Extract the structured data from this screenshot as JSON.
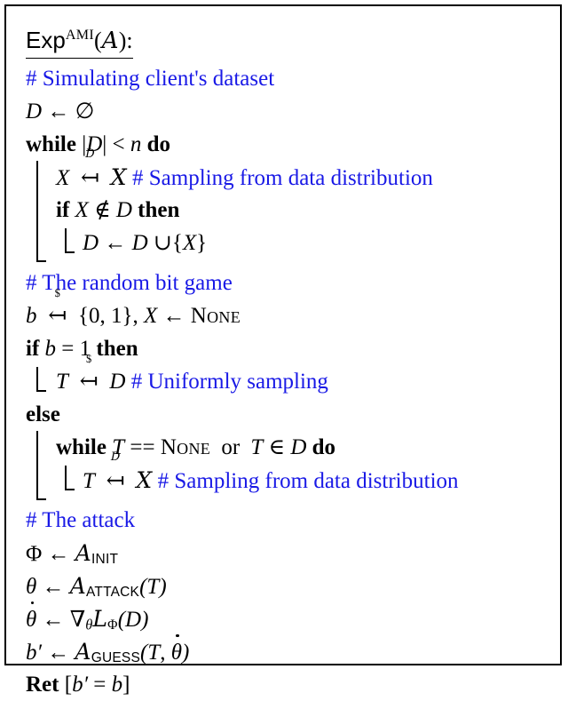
{
  "figure": {
    "kind": "algorithm-pseudocode",
    "comment_color": "#1919E6",
    "text_color": "#000000",
    "border_color": "#000000",
    "background": "#ffffff"
  },
  "title": {
    "name": "Exp",
    "superscript": "AMI",
    "open_paren": "(",
    "adversary": "A",
    "close_paren": "):"
  },
  "lines": {
    "c1": "# Simulating client's dataset",
    "l2_lhs": "D",
    "l2_arrow": "←",
    "l2_rhs": "∅",
    "l3_while": "while",
    "l3_cond_a": "|",
    "l3_cond_d": "D",
    "l3_cond_b": "|",
    "l3_lt": "<",
    "l3_n": "n",
    "l3_do": "do",
    "l4_x": "X",
    "l4_arrow": "↤",
    "l4_label": "D",
    "l4_set": "X",
    "l4_comment": "# Sampling from data distribution",
    "l5_if": "if",
    "l5_x": "X",
    "l5_notin": "∉",
    "l5_d": "D",
    "l5_then": "then",
    "l6_d1": "D",
    "l6_arrow": "←",
    "l6_d2": "D",
    "l6_cup": "∪",
    "l6_open": "{",
    "l6_x": "X",
    "l6_close": "}",
    "c2": "# The random bit game",
    "l8_b": "b",
    "l8_arrow": "↤",
    "l8_label": "$",
    "l8_set": "{0, 1}",
    "l8_comma": ",",
    "l8_x": "X",
    "l8_arrow2": "←",
    "l8_none": "None",
    "l9_if": "if",
    "l9_b": "b",
    "l9_eq": "=",
    "l9_one": "1",
    "l9_then": "then",
    "l10_t": "T",
    "l10_arrow": "↤",
    "l10_label": "$",
    "l10_d": "D",
    "l10_comment": "# Uniformly sampling",
    "l11_else": "else",
    "l12_while": "while",
    "l12_t": "T",
    "l12_eqeq": "==",
    "l12_none": "None",
    "l12_or": "or",
    "l12_t2": "T",
    "l12_in": "∈",
    "l12_d": "D",
    "l12_do": "do",
    "l13_t": "T",
    "l13_arrow": "↤",
    "l13_label": "D",
    "l13_set": "X",
    "l13_comment": "# Sampling from data distribution",
    "c3": "# The attack",
    "l15_phi": "Φ",
    "l15_arrow": "←",
    "l15_adv": "A",
    "l15_sub": "INIT",
    "l16_theta": "θ",
    "l16_arrow": "←",
    "l16_adv": "A",
    "l16_sub": "ATTACK",
    "l16_args": "(T)",
    "l17_theta": "θ",
    "l17_arrow": "←",
    "l17_nabla": "∇",
    "l17_nabla_sub": "θ",
    "l17_loss": "L",
    "l17_loss_sub": "Φ",
    "l17_args": "(D)",
    "l18_bprime": "b′",
    "l18_arrow": "←",
    "l18_adv": "A",
    "l18_sub": "GUESS",
    "l18_open": "(",
    "l18_t": "T",
    "l18_comma": ",",
    "l18_theta": "θ",
    "l18_close": ")",
    "l19_ret": "Ret",
    "l19_open": "[",
    "l19_bprime": "b′",
    "l19_eq": "=",
    "l19_b": "b",
    "l19_close": "]"
  }
}
